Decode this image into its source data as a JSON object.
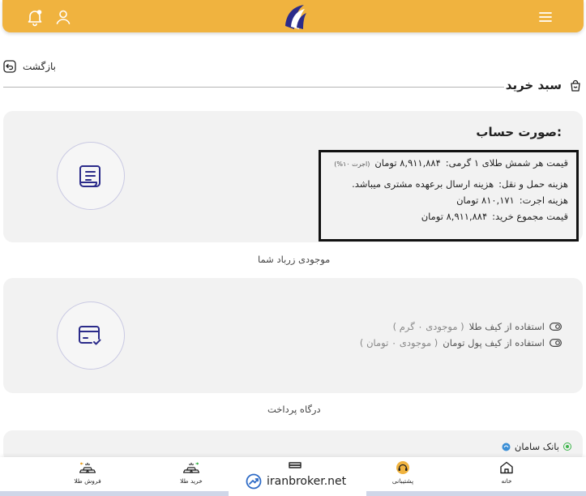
{
  "header": {
    "icons": [
      "bell-icon",
      "user-icon",
      "logo",
      "menu-icon"
    ],
    "background_color": "#F0B33F"
  },
  "nav": {
    "back_label": "بازگشت"
  },
  "cart": {
    "title": "سبد خرید"
  },
  "invoice": {
    "title": "صورت حساب:",
    "unit_price_label": "قیمت هر شمش طلای ۱ گرمی:",
    "unit_price_value": "۸,۹۱۱,۸۸۴ تومان",
    "wage_note": "(اجرت ۱۰%)",
    "shipping_label": "هزینه حمل و نقل:",
    "shipping_value": "هزینه ارسال برعهده مشتری میباشد.",
    "wage_label": "هزینه اجرت:",
    "wage_value": "۸۱۰,۱۷۱ تومان",
    "total_label": "قیمت مجموع خرید:",
    "total_value": "۸,۹۱۱,۸۸۴ تومان"
  },
  "wallet": {
    "section_label": "موجودی زرباد شما",
    "options": [
      {
        "label": "استفاده از کیف طلا",
        "balance": "( موجودی ۰ گرم )"
      },
      {
        "label": "استفاده از کیف پول تومان",
        "balance": "( موجودی ۰ تومان )"
      }
    ]
  },
  "gateway": {
    "section_label": "درگاه پرداخت",
    "bank_name": "بانک سامان"
  },
  "bottom_nav": {
    "home": "خانه",
    "support": "پشتیبانی",
    "buy_gold": "خرید طلا",
    "sell_gold": "فروش طلا"
  },
  "watermark": "iranbroker.net"
}
